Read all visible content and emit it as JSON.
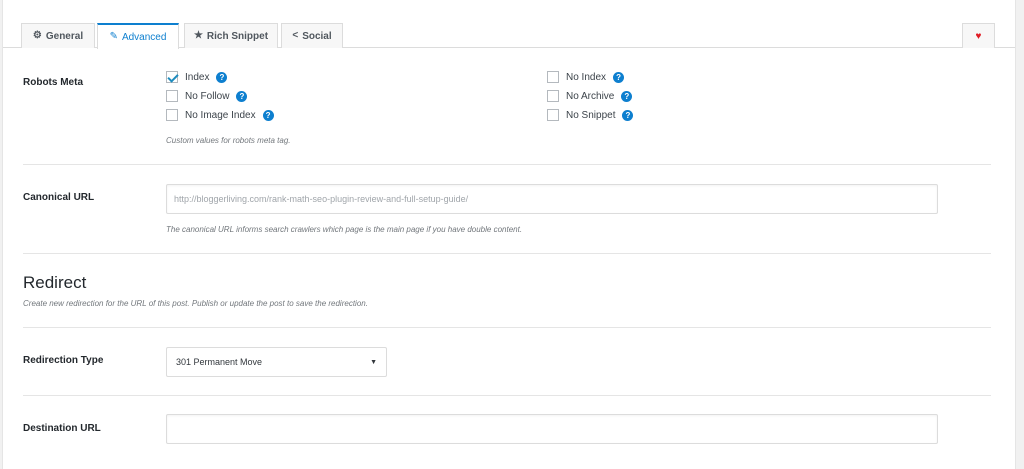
{
  "tabs": [
    {
      "label": "General",
      "icon": "gear-icon",
      "glyph": "⚙"
    },
    {
      "label": "Advanced",
      "icon": "wrench-icon",
      "glyph": "✎"
    },
    {
      "label": "Rich Snippet",
      "icon": "star-icon",
      "glyph": "★"
    },
    {
      "label": "Social",
      "icon": "share-icon",
      "glyph": "<"
    }
  ],
  "active_tab": "Advanced",
  "heart": {
    "icon": "heart-icon",
    "glyph": "♥"
  },
  "robots": {
    "label": "Robots Meta",
    "options": [
      {
        "label": "Index",
        "checked": true
      },
      {
        "label": "No Follow",
        "checked": false
      },
      {
        "label": "No Image Index",
        "checked": false
      },
      {
        "label": "No Index",
        "checked": false
      },
      {
        "label": "No Archive",
        "checked": false
      },
      {
        "label": "No Snippet",
        "checked": false
      }
    ],
    "description": "Custom values for robots meta tag."
  },
  "canonical": {
    "label": "Canonical URL",
    "placeholder": "http://bloggerliving.com/rank-math-seo-plugin-review-and-full-setup-guide/",
    "value": "",
    "description": "The canonical URL informs search crawlers which page is the main page if you have double content."
  },
  "redirect": {
    "title": "Redirect",
    "description": "Create new redirection for the URL of this post. Publish or update the post to save the redirection.",
    "type_label": "Redirection Type",
    "type_value": "301 Permanent Move",
    "destination_label": "Destination URL",
    "destination_value": ""
  },
  "colors": {
    "accent": "#0d7fcf",
    "heart": "#e01b24"
  }
}
